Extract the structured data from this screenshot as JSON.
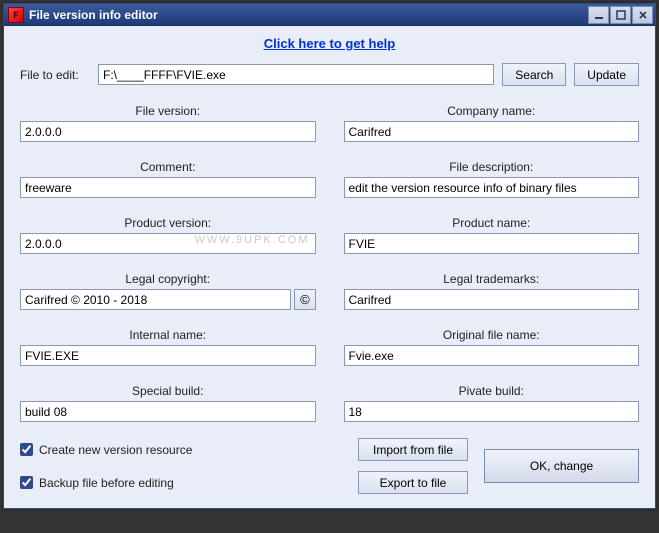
{
  "titlebar": {
    "title": "File version info editor",
    "icon_label": "F"
  },
  "help_link": "Click here to get help",
  "file_row": {
    "label": "File to edit:",
    "path": "F:\\____FFFF\\FVIE.exe",
    "search_btn": "Search",
    "update_btn": "Update"
  },
  "fields": {
    "file_version": {
      "label": "File version:",
      "value": "2.0.0.0"
    },
    "company_name": {
      "label": "Company name:",
      "value": "Carifred"
    },
    "comment": {
      "label": "Comment:",
      "value": "freeware"
    },
    "file_description": {
      "label": "File description:",
      "value": "edit the version resource info of binary files"
    },
    "product_version": {
      "label": "Product version:",
      "value": "2.0.0.0"
    },
    "product_name": {
      "label": "Product name:",
      "value": "FVIE"
    },
    "legal_copyright": {
      "label": "Legal copyright:",
      "value": "Carifred © 2010 - 2018"
    },
    "legal_trademarks": {
      "label": "Legal trademarks:",
      "value": "Carifred"
    },
    "internal_name": {
      "label": "Internal name:",
      "value": "FVIE.EXE"
    },
    "original_file_name": {
      "label": "Original file name:",
      "value": "Fvie.exe"
    },
    "special_build": {
      "label": "Special build:",
      "value": "build 08"
    },
    "private_build": {
      "label": "Pivate build:",
      "value": "18"
    }
  },
  "copyright_icon": "©",
  "watermark": "WWW.9UPK.COM",
  "bottom": {
    "create_new": "Create new version resource",
    "backup": "Backup file before editing",
    "import_btn": "Import from file",
    "export_btn": "Export to file",
    "ok_btn": "OK, change"
  }
}
